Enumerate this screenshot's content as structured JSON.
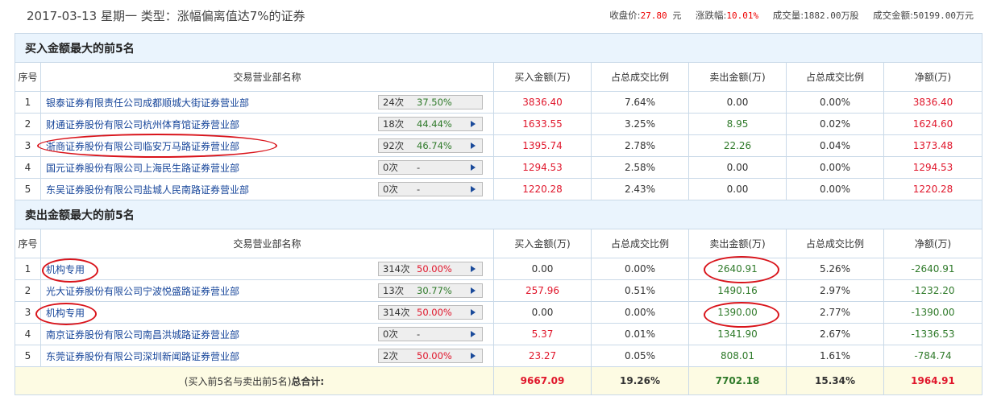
{
  "header": {
    "title": "2017-03-13 星期一  类型：涨幅偏离值达7%的证券",
    "close_label": "收盘价:",
    "close_value": "27.80",
    "close_unit": "元",
    "change_label": "涨跌幅:",
    "change_value": "10.01%",
    "volume_label": "成交量:",
    "volume_value": "1882.00万股",
    "amount_label": "成交金额:",
    "amount_value": "50199.00万元"
  },
  "columns": [
    "序号",
    "交易营业部名称",
    "买入金额(万)",
    "占总成交比例",
    "卖出金额(万)",
    "占总成交比例",
    "净额(万)"
  ],
  "buy_section": {
    "title": "买入金额最大的前5名",
    "rows": [
      {
        "no": "1",
        "name": "银泰证券有限责任公司成都顺城大街证券营业部",
        "count": "24次",
        "pct": "37.50%",
        "pct_color": "green",
        "arrow": false,
        "buy": "3836.40",
        "buy_ratio": "7.64%",
        "sell": "0.00",
        "sell_ratio": "0.00%",
        "net": "3836.40"
      },
      {
        "no": "2",
        "name": "财通证券股份有限公司杭州体育馆证券营业部",
        "count": "18次",
        "pct": "44.44%",
        "pct_color": "green",
        "arrow": true,
        "buy": "1633.55",
        "buy_ratio": "3.25%",
        "sell": "8.95",
        "sell_ratio": "0.02%",
        "net": "1624.60"
      },
      {
        "no": "3",
        "name": "浙商证券股份有限公司临安万马路证券营业部",
        "count": "92次",
        "pct": "46.74%",
        "pct_color": "green",
        "arrow": true,
        "buy": "1395.74",
        "buy_ratio": "2.78%",
        "sell": "22.26",
        "sell_ratio": "0.04%",
        "net": "1373.48"
      },
      {
        "no": "4",
        "name": "国元证券股份有限公司上海民生路证券营业部",
        "count": "0次",
        "pct": "-",
        "pct_color": "gray",
        "arrow": true,
        "buy": "1294.53",
        "buy_ratio": "2.58%",
        "sell": "0.00",
        "sell_ratio": "0.00%",
        "net": "1294.53"
      },
      {
        "no": "5",
        "name": "东吴证券股份有限公司盐城人民南路证券营业部",
        "count": "0次",
        "pct": "-",
        "pct_color": "gray",
        "arrow": true,
        "buy": "1220.28",
        "buy_ratio": "2.43%",
        "sell": "0.00",
        "sell_ratio": "0.00%",
        "net": "1220.28"
      }
    ]
  },
  "sell_section": {
    "title": "卖出金额最大的前5名",
    "rows": [
      {
        "no": "1",
        "name": "机构专用",
        "count": "314次",
        "pct": "50.00%",
        "pct_color": "red",
        "arrow": true,
        "buy": "0.00",
        "buy_ratio": "0.00%",
        "sell": "2640.91",
        "sell_ratio": "5.26%",
        "net": "-2640.91"
      },
      {
        "no": "2",
        "name": "光大证券股份有限公司宁波悦盛路证券营业部",
        "count": "13次",
        "pct": "30.77%",
        "pct_color": "green",
        "arrow": true,
        "buy": "257.96",
        "buy_ratio": "0.51%",
        "sell": "1490.16",
        "sell_ratio": "2.97%",
        "net": "-1232.20"
      },
      {
        "no": "3",
        "name": "机构专用",
        "count": "314次",
        "pct": "50.00%",
        "pct_color": "red",
        "arrow": true,
        "buy": "0.00",
        "buy_ratio": "0.00%",
        "sell": "1390.00",
        "sell_ratio": "2.77%",
        "net": "-1390.00"
      },
      {
        "no": "4",
        "name": "南京证券股份有限公司南昌洪城路证券营业部",
        "count": "0次",
        "pct": "-",
        "pct_color": "gray",
        "arrow": true,
        "buy": "5.37",
        "buy_ratio": "0.01%",
        "sell": "1341.90",
        "sell_ratio": "2.67%",
        "net": "-1336.53"
      },
      {
        "no": "5",
        "name": "东莞证券股份有限公司深圳新闻路证券营业部",
        "count": "2次",
        "pct": "50.00%",
        "pct_color": "red",
        "arrow": true,
        "buy": "23.27",
        "buy_ratio": "0.05%",
        "sell": "808.01",
        "sell_ratio": "1.61%",
        "net": "-784.74"
      }
    ]
  },
  "total": {
    "label_prefix": "(买入前5名与卖出前5名)",
    "label_bold": "总合计:",
    "buy": "9667.09",
    "buy_ratio": "19.26%",
    "sell": "7702.18",
    "sell_ratio": "15.34%",
    "net": "1964.91"
  },
  "colors": {
    "red": "#e0162b",
    "green": "#2f7a2a",
    "link": "#16459a",
    "header_bg": "#eaf4fd",
    "total_bg": "#fdfbe3",
    "annotation": "#d9141b"
  }
}
